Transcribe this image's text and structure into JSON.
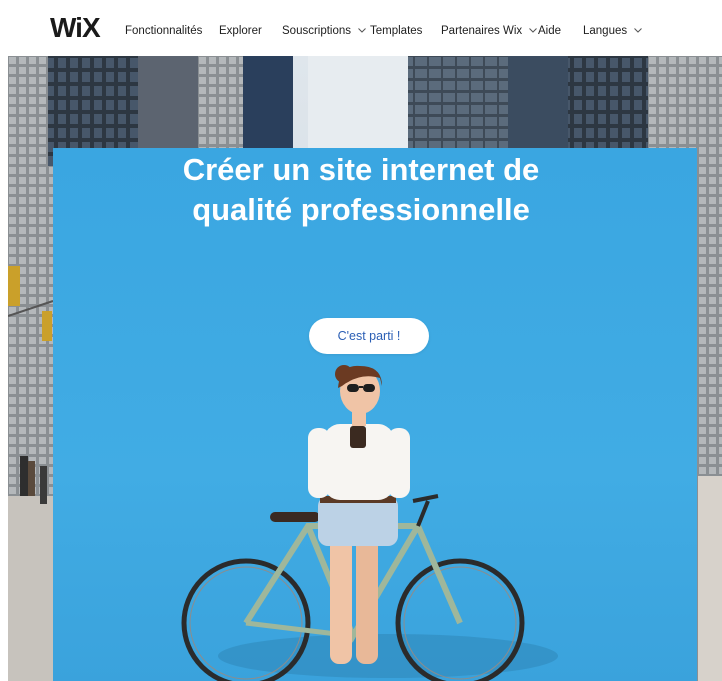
{
  "header": {
    "logo": "WiX",
    "nav": [
      {
        "label": "Fonctionnalités",
        "has_dropdown": false
      },
      {
        "label": "Explorer",
        "has_dropdown": false
      },
      {
        "label": "Souscriptions",
        "has_dropdown": true
      },
      {
        "label": "Templates",
        "has_dropdown": false
      },
      {
        "label": "Partenaires Wix",
        "has_dropdown": true
      },
      {
        "label": "Aide",
        "has_dropdown": false
      },
      {
        "label": "Langues",
        "has_dropdown": true
      }
    ]
  },
  "hero": {
    "headline_line1": "Créer un site internet de",
    "headline_line2": "qualité professionnelle",
    "cta_label": "C'est parti !",
    "panel_color": "#3DA8E2",
    "cta_text_color": "#2B5FB5"
  },
  "icons": {
    "dropdown": "chevron-down-icon"
  }
}
